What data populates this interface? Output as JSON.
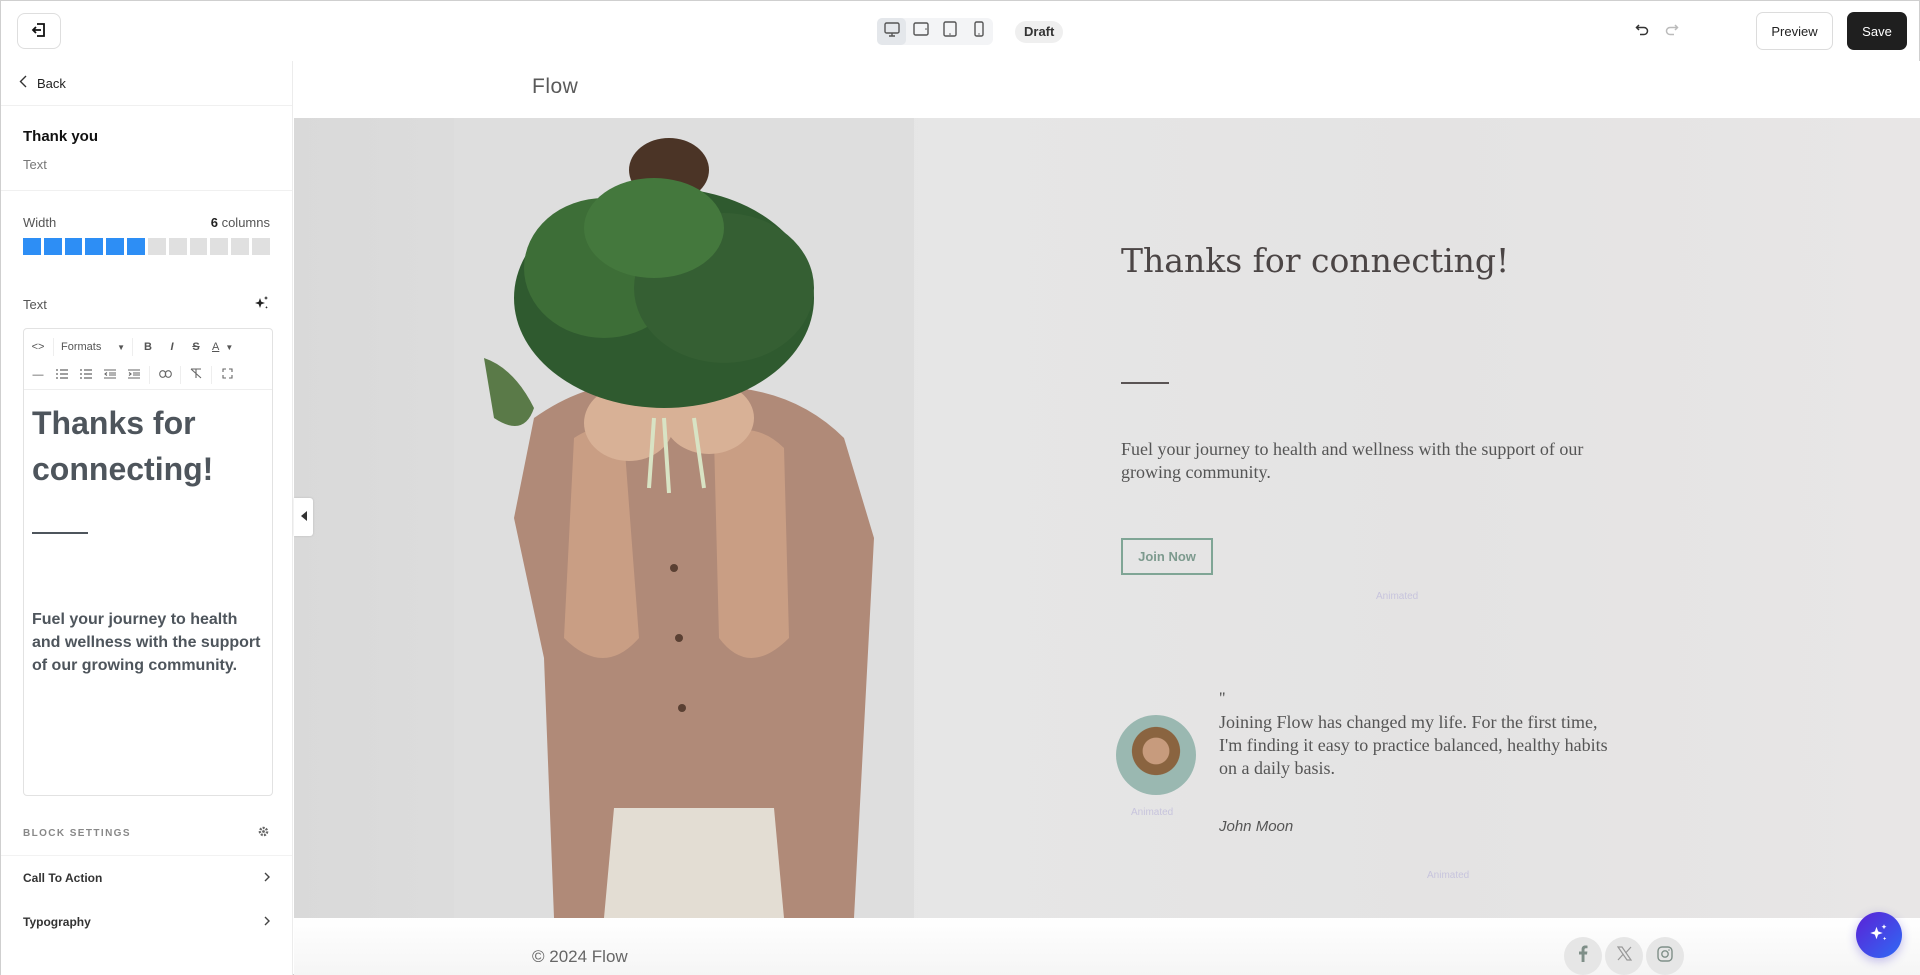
{
  "topbar": {
    "exit_icon": "exit-editor-icon",
    "devices": [
      {
        "name": "desktop",
        "icon": "desktop-icon",
        "active": true
      },
      {
        "name": "tablet-landscape",
        "icon": "tablet-landscape-icon",
        "active": false
      },
      {
        "name": "tablet-portrait",
        "icon": "tablet-portrait-icon",
        "active": false
      },
      {
        "name": "mobile",
        "icon": "mobile-icon",
        "active": false
      }
    ],
    "status_badge": "Draft",
    "undo_icon": "undo-icon",
    "redo_icon": "redo-icon",
    "preview_label": "Preview",
    "save_label": "Save"
  },
  "sidebar": {
    "back_label": "Back",
    "block_title": "Thank you",
    "block_type": "Text",
    "width": {
      "label": "Width",
      "value": "6",
      "unit": "columns",
      "selected_columns": 6,
      "total_columns": 12
    },
    "text_label": "Text",
    "ai_icon": "sparkle-icon",
    "editor": {
      "toolbar_row1": [
        "source-code",
        "Formats",
        "bold",
        "italic",
        "strikethrough",
        "text-color"
      ],
      "formats_label": "Formats",
      "toolbar_row2": [
        "horizontal-rule",
        "bullet-list",
        "numbered-list",
        "outdent",
        "indent",
        "link",
        "clear-formatting",
        "fullscreen"
      ],
      "heading": "Thanks for connecting!",
      "paragraph": "Fuel your journey to health and wellness with the support of our growing community."
    },
    "block_settings_label": "BLOCK SETTINGS",
    "settings_items": [
      {
        "label": "Call To Action"
      },
      {
        "label": "Typography"
      }
    ]
  },
  "site": {
    "logo": "Flow",
    "hero": {
      "title": "Thanks for connecting!",
      "text": "Fuel your journey to health and wellness with the support of our growing community.",
      "cta_label": "Join Now",
      "animated_label": "Animated"
    },
    "testimonial": {
      "quote_mark": "\"",
      "quote": "Joining Flow has changed my life. For the first time, I'm finding it easy to practice balanced, healthy habits on a daily basis.",
      "author": "John Moon",
      "avatar_label": "Animated",
      "block_label": "Animated"
    },
    "footer": {
      "copyright": "© 2024 Flow",
      "social": [
        "facebook",
        "x",
        "instagram"
      ]
    }
  },
  "colors": {
    "accent_blue": "#2d8ef5",
    "save_bg": "#1f1f1f",
    "cta_border": "#7fa595",
    "ai_fab_start": "#5b21d6",
    "ai_fab_end": "#2f6af5"
  }
}
